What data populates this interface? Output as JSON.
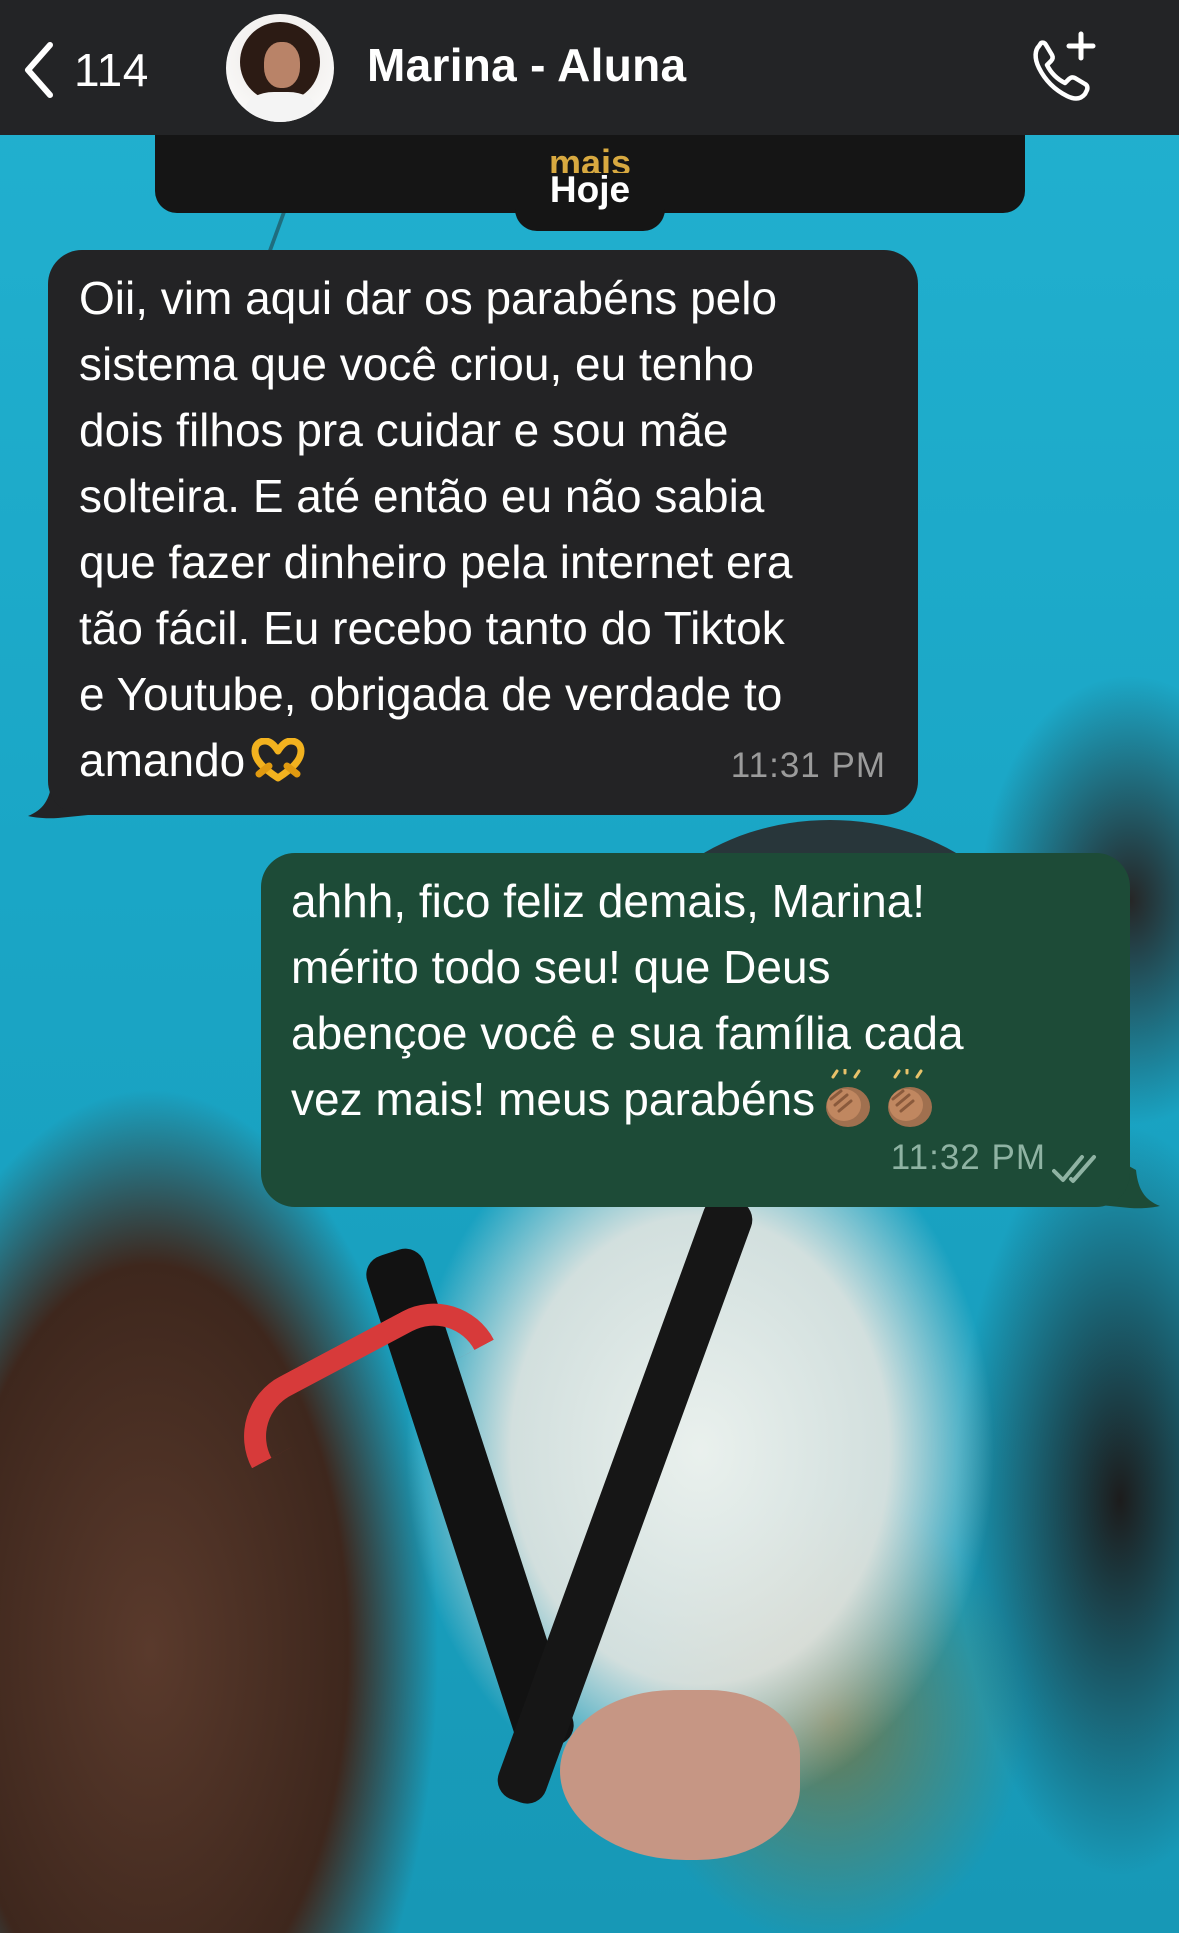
{
  "header": {
    "back_count": "114",
    "contact_name": "Marina - Aluna"
  },
  "pinned": {
    "label": "mais"
  },
  "date_separator": "Hoje",
  "messages": [
    {
      "direction": "incoming",
      "text": "Oii, vim aqui dar os parabéns pelo\nsistema que você criou, eu tenho\ndois filhos pra cuidar e sou mãe\nsolteira. E até então eu não sabia\nque fazer dinheiro pela internet era\ntão fácil. Eu recebo tanto do Tiktok\ne Youtube, obrigada de verdade to\namando",
      "emoji": "heart-hands-emoji",
      "time": "11:31 PM"
    },
    {
      "direction": "outgoing",
      "text": "ahhh, fico feliz demais, Marina!\nmérito todo seu! que Deus\nabençoe você e sua família cada\nvez mais! meus parabéns",
      "emoji": "clapping-hands-emoji",
      "time": "11:32 PM",
      "status": "read"
    }
  ],
  "colors": {
    "header_bg": "#232426",
    "incoming_bubble": "#232325",
    "outgoing_bubble": "#1d4b37",
    "pinned_label": "#d8a940",
    "read_ticks": "#8fb3a3"
  },
  "icons": {
    "back": "chevron-left-icon",
    "call": "phone-plus-icon",
    "status": "double-check-icon"
  }
}
